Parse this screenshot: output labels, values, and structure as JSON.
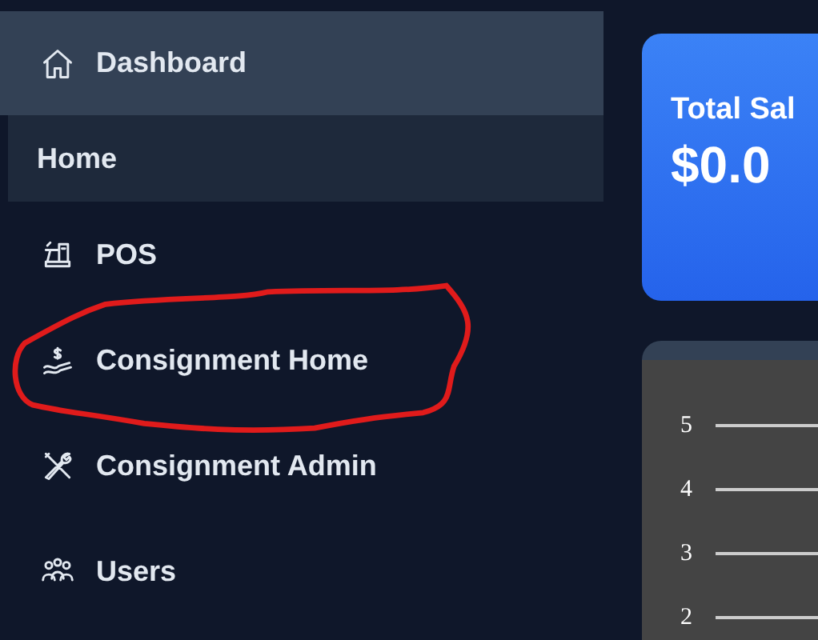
{
  "sidebar": {
    "header": {
      "label": "Dashboard"
    },
    "section": {
      "label": "Home"
    },
    "items": [
      {
        "label": "POS",
        "circled": false
      },
      {
        "label": "Consignment Home",
        "circled": true
      },
      {
        "label": "Consignment Admin",
        "circled": false
      },
      {
        "label": "Users",
        "circled": false
      }
    ]
  },
  "stat_card": {
    "title": "Total Sal",
    "value": "$0.0"
  },
  "chart": {
    "y_labels": [
      "5",
      "4",
      "3",
      "2"
    ]
  }
}
